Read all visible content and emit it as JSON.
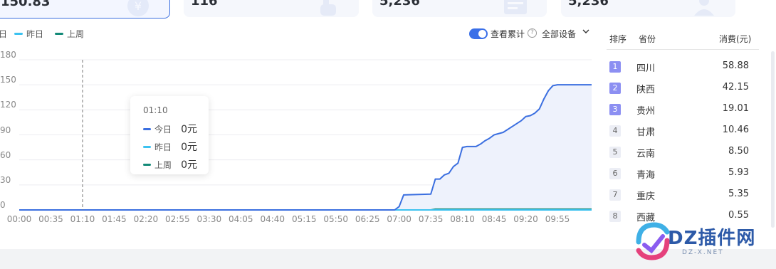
{
  "kpi_cards": [
    {
      "value": "150.83",
      "icon": "yuan-icon"
    },
    {
      "value": "116",
      "icon": "hand-pointer-icon"
    },
    {
      "value": "5,236",
      "icon": "card-icon"
    },
    {
      "value": "5,236",
      "icon": "user-icon"
    }
  ],
  "legend": {
    "today": "日",
    "yesterday": "昨日",
    "last_week": "上周"
  },
  "controls": {
    "cumulative_label": "查看累计",
    "cumulative_on": true,
    "help": "?",
    "device_select": "全部设备"
  },
  "tooltip": {
    "time": "01:10",
    "rows": [
      {
        "label": "今日",
        "value": "0元"
      },
      {
        "label": "昨日",
        "value": "0元"
      },
      {
        "label": "上周",
        "value": "0元"
      }
    ]
  },
  "colors": {
    "today": "#3b6fe0",
    "yesterday": "#3cc2f0",
    "last_week": "#138a78"
  },
  "chart_data": {
    "type": "line",
    "title": "",
    "xlabel": "",
    "ylabel": "",
    "ylim": [
      0,
      180
    ],
    "yticks": [
      "0",
      "30",
      "60",
      "90",
      "120",
      "150",
      "180"
    ],
    "xticks": [
      "00:00",
      "00:35",
      "01:10",
      "01:45",
      "02:20",
      "02:55",
      "03:30",
      "04:05",
      "04:40",
      "05:15",
      "05:50",
      "06:25",
      "07:00",
      "07:35",
      "08:10",
      "08:45",
      "09:20",
      "09:55"
    ],
    "grid": true,
    "cursor_at": "01:10",
    "series": [
      {
        "name": "今日",
        "color": "#3b6fe0",
        "area": true,
        "points": [
          [
            "00:00",
            0
          ],
          [
            "06:55",
            0
          ],
          [
            "07:00",
            4
          ],
          [
            "07:05",
            18
          ],
          [
            "07:35",
            19
          ],
          [
            "07:40",
            37
          ],
          [
            "07:45",
            37
          ],
          [
            "07:50",
            42
          ],
          [
            "07:55",
            44
          ],
          [
            "08:00",
            52
          ],
          [
            "08:05",
            56
          ],
          [
            "08:10",
            75
          ],
          [
            "08:15",
            76
          ],
          [
            "08:25",
            76
          ],
          [
            "08:30",
            79
          ],
          [
            "08:35",
            83
          ],
          [
            "08:40",
            86
          ],
          [
            "08:45",
            90
          ],
          [
            "08:55",
            93
          ],
          [
            "09:05",
            100
          ],
          [
            "09:15",
            107
          ],
          [
            "09:20",
            112
          ],
          [
            "09:25",
            113
          ],
          [
            "09:30",
            116
          ],
          [
            "09:35",
            121
          ],
          [
            "09:40",
            133
          ],
          [
            "09:45",
            143
          ],
          [
            "09:50",
            149
          ],
          [
            "09:55",
            150
          ]
        ]
      },
      {
        "name": "昨日",
        "color": "#3cc2f0",
        "points": [
          [
            "00:00",
            0
          ],
          [
            "09:55",
            0
          ]
        ]
      },
      {
        "name": "上周",
        "color": "#138a78",
        "points": [
          [
            "00:00",
            0
          ],
          [
            "07:35",
            0
          ],
          [
            "07:40",
            1
          ],
          [
            "09:55",
            1
          ]
        ]
      }
    ]
  },
  "table": {
    "headers": {
      "rank": "排序",
      "province": "省份",
      "cost": "消费(元)"
    },
    "rows": [
      {
        "rank": "1",
        "province": "四川",
        "cost": "58.88"
      },
      {
        "rank": "2",
        "province": "陕西",
        "cost": "42.15"
      },
      {
        "rank": "3",
        "province": "贵州",
        "cost": "19.01"
      },
      {
        "rank": "4",
        "province": "甘肃",
        "cost": "10.46"
      },
      {
        "rank": "5",
        "province": "云南",
        "cost": "8.50"
      },
      {
        "rank": "6",
        "province": "青海",
        "cost": "5.93"
      },
      {
        "rank": "7",
        "province": "重庆",
        "cost": "5.35"
      },
      {
        "rank": "8",
        "province": "西藏",
        "cost": "0.55"
      }
    ]
  },
  "watermark": {
    "logo": "DZ插件网",
    "url": "DZ-X.NET"
  }
}
